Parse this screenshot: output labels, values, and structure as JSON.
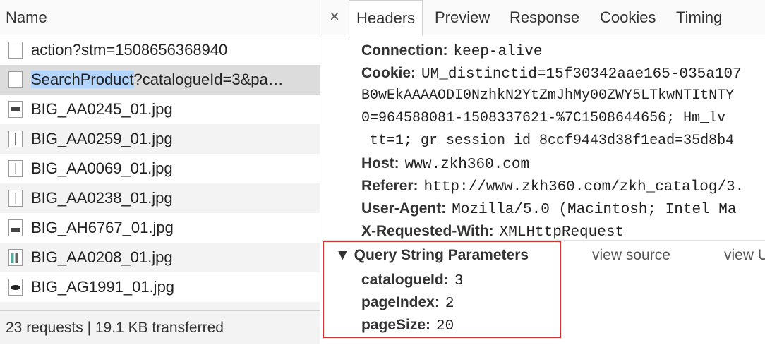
{
  "network": {
    "column_header": "Name",
    "rows": [
      {
        "icon": "document-icon",
        "text": "action?stm=1508656368940"
      },
      {
        "icon": "document-icon",
        "highlight": "SearchProduct",
        "text": "?catalogueId=3&pa…"
      },
      {
        "icon": "image-thumbnail-icon",
        "text": "BIG_AA0245_01.jpg"
      },
      {
        "icon": "image-thumbnail-icon",
        "text": "BIG_AA0259_01.jpg"
      },
      {
        "icon": "image-thumbnail-icon",
        "text": "BIG_AA0069_01.jpg"
      },
      {
        "icon": "image-thumbnail-icon",
        "text": "BIG_AA0238_01.jpg"
      },
      {
        "icon": "image-thumbnail-icon",
        "text": "BIG_AH6767_01.jpg"
      },
      {
        "icon": "image-thumbnail-icon",
        "text": "BIG_AA0208_01.jpg"
      },
      {
        "icon": "image-thumbnail-icon",
        "text": "BIG_AG1991_01.jpg"
      }
    ],
    "footer": "23 requests | 19.1 KB transferred"
  },
  "detail": {
    "close_glyph": "×",
    "tabs": [
      "Headers",
      "Preview",
      "Response",
      "Cookies",
      "Timing"
    ],
    "active_tab": "Headers",
    "headers": {
      "connection": {
        "key": "Connection:",
        "value": "keep-alive"
      },
      "cookie": {
        "key": "Cookie:",
        "value": "UM_distinctid=15f30342aae165-035a107",
        "cont": [
          "B0wEkAAAAODI0NzhkN2YtZmJhMy00ZWY5LTkwNTItNTY",
          "0=964588081-1508337621-%7C1508644656; Hm_lv",
          " tt=1; gr_session_id_8ccf9443d38f1ead=35d8b4"
        ]
      },
      "host": {
        "key": "Host:",
        "value": "www.zkh360.com"
      },
      "referer": {
        "key": "Referer:",
        "value": "http://www.zkh360.com/zkh_catalog/3."
      },
      "user_agent": {
        "key": "User-Agent:",
        "value": "Mozilla/5.0 (Macintosh; Intel Ma"
      },
      "x_requested_with": {
        "key": "X-Requested-With:",
        "value": "XMLHttpRequest"
      }
    },
    "query": {
      "title": "▼ Query String Parameters",
      "view_source": "view source",
      "view_url": "view U",
      "params": [
        {
          "key": "catalogueId:",
          "value": "3"
        },
        {
          "key": "pageIndex:",
          "value": "2"
        },
        {
          "key": "pageSize:",
          "value": "20"
        }
      ]
    }
  },
  "colors": {
    "selection_highlight": "#b3d4fd",
    "annotation_box": "#d9302c"
  }
}
